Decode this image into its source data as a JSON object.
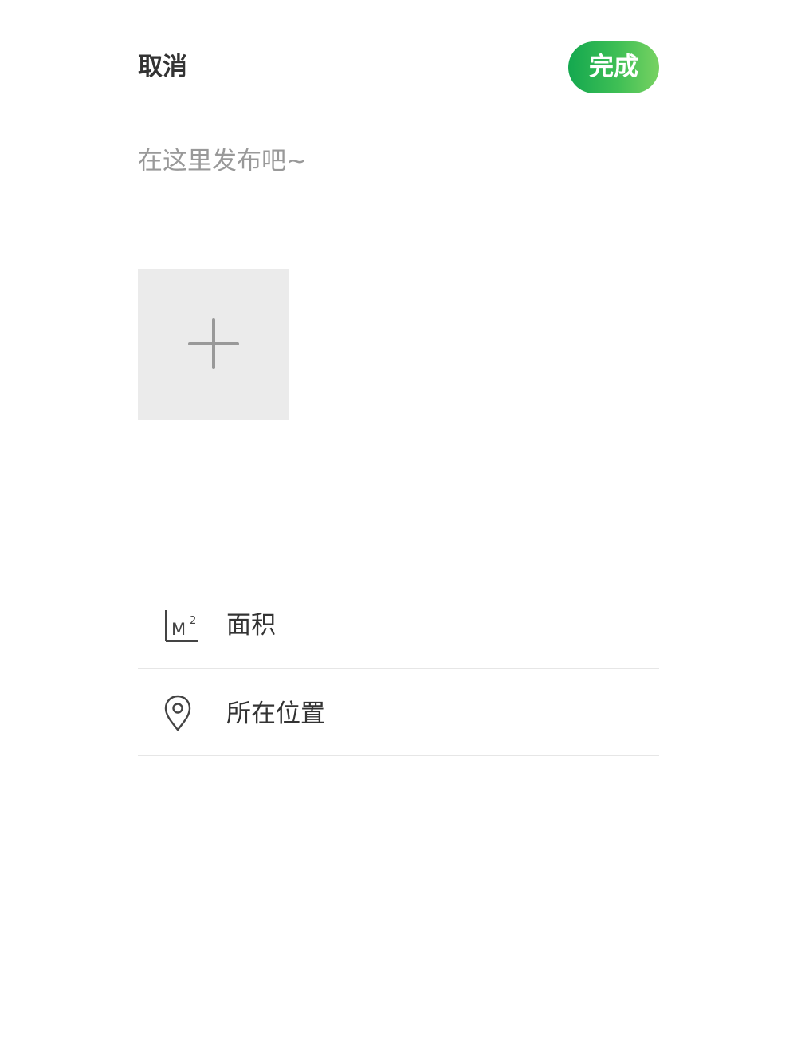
{
  "header": {
    "cancel_label": "取消",
    "done_label": "完成",
    "accent_gradient": [
      "#14a84f",
      "#78d262"
    ]
  },
  "post": {
    "placeholder": "在这里发布吧~",
    "value": ""
  },
  "upload": {
    "icon": "plus-icon",
    "background_color": "#ebebeb"
  },
  "fields": [
    {
      "icon": "area-m2-icon",
      "label": "面积"
    },
    {
      "icon": "location-pin-icon",
      "label": "所在位置"
    }
  ]
}
